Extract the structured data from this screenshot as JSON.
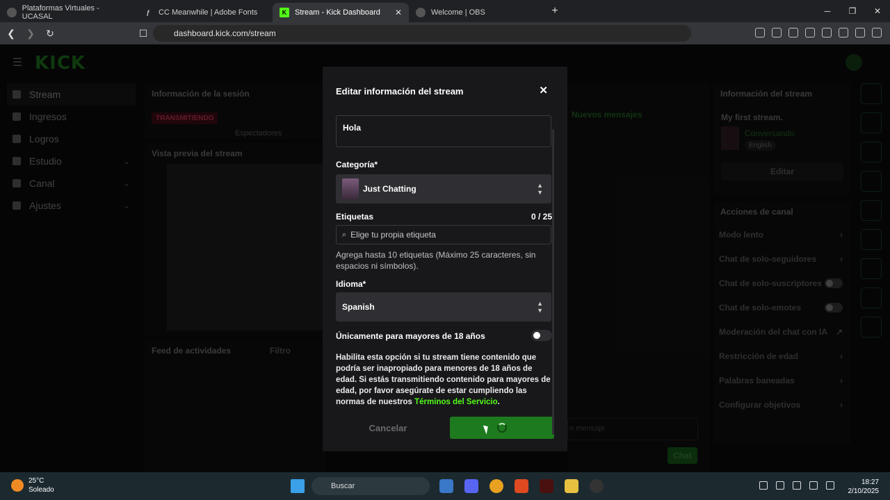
{
  "browser": {
    "tabs": [
      {
        "label": "Plataformas Virtuales - UCASAL",
        "active": false
      },
      {
        "label": "CC Meanwhile | Adobe Fonts",
        "active": false
      },
      {
        "label": "Stream - Kick Dashboard",
        "active": true
      },
      {
        "label": "Welcome | OBS",
        "active": false
      }
    ],
    "url": "dashboard.kick.com/stream"
  },
  "page": {
    "logo": "KICK",
    "sidebar": [
      {
        "label": "Stream",
        "active": true,
        "chevron": false
      },
      {
        "label": "Ingresos",
        "chevron": false
      },
      {
        "label": "Logros",
        "chevron": false
      },
      {
        "label": "Estudio",
        "chevron": true
      },
      {
        "label": "Canal",
        "chevron": true
      },
      {
        "label": "Ajustes",
        "chevron": true
      }
    ],
    "session_panel": {
      "title": "Información de la sesión",
      "badge": "TRANSMITIENDO",
      "viewers": "Espectadores"
    },
    "preview_panel": {
      "title": "Vista previa del stream"
    },
    "feed_panel": {
      "title": "Feed de actividades",
      "filter": "Filtro"
    },
    "chat_panel": {
      "new_messages": "Nuevos mensajes",
      "placeholder": "n mensaje",
      "send": "Chat"
    },
    "stream_info": {
      "title": "Información del stream",
      "stream_title": "My first stream.",
      "category": "Conversando",
      "language": "English",
      "edit": "Editar"
    },
    "channel_actions": {
      "title": "Acciones de canal",
      "items": [
        {
          "label": "Modo lento",
          "type": "chevron"
        },
        {
          "label": "Chat de solo-seguidores",
          "type": "chevron"
        },
        {
          "label": "Chat de solo-suscriptores",
          "type": "toggle"
        },
        {
          "label": "Chat de solo-emotes",
          "type": "toggle"
        },
        {
          "label": "Moderación del chat con IA",
          "type": "external"
        },
        {
          "label": "Restricción de edad",
          "type": "chevron"
        },
        {
          "label": "Palabras baneadas",
          "type": "chevron"
        },
        {
          "label": "Configurar objetivos",
          "type": "chevron"
        }
      ]
    }
  },
  "modal": {
    "title": "Editar información del stream",
    "stream_title_value": "Hola",
    "category_label": "Categoría*",
    "category_value": "Just Chatting",
    "tags_label": "Etiquetas",
    "tags_count": "0 / 25",
    "tags_placeholder": "Elige tu propia etiqueta",
    "tags_hint": "Agrega hasta 10 etiquetas (Máximo 25 caracteres, sin espacios ni símbolos).",
    "language_label": "Idioma*",
    "language_value": "Spanish",
    "adult_label": "Únicamente para mayores de 18 años",
    "adult_desc": "Habilita esta opción si tu stream tiene contenido que podría ser inapropiado para menores de 18 años de edad. Si estás transmitiendo contenido para mayores de edad, por favor asegúrate de estar cumpliendo las normas de nuestros",
    "terms_link": "Términos del Servicio",
    "terms_end": ".",
    "cancel": "Cancelar"
  },
  "taskbar": {
    "temp": "25°C",
    "weather": "Soleado",
    "search": "Buscar",
    "time": "18:27",
    "date": "2/10/2025"
  },
  "colors": {
    "accent": "#53fc18",
    "live": "#e91e3a"
  }
}
